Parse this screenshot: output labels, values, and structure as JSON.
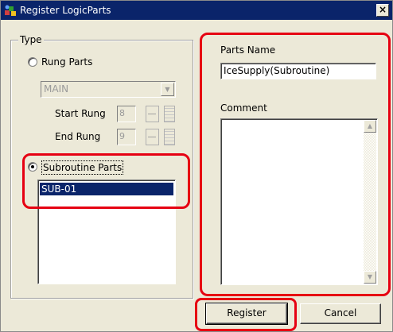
{
  "window": {
    "title": "Register LogicParts",
    "close_glyph": "×",
    "app_icon": "logicparts-app-icon"
  },
  "type_group": {
    "legend": "Type",
    "rung_parts": {
      "label": "Rung Parts",
      "checked": false,
      "combo_value": "MAIN",
      "start_label": "Start Rung",
      "start_value": "8",
      "end_label": "End Rung",
      "end_value": "9"
    },
    "subroutine_parts": {
      "label": "Subroutine Parts",
      "checked": true,
      "items": [
        "SUB-01"
      ],
      "selected_index": 0
    }
  },
  "parts_name": {
    "label": "Parts Name",
    "value": "IceSupply(Subroutine)"
  },
  "comment": {
    "label": "Comment",
    "value": ""
  },
  "buttons": {
    "register": "Register",
    "cancel": "Cancel"
  },
  "glyphs": {
    "dropdown": "▼",
    "scroll_up": "▲",
    "scroll_down": "▼"
  },
  "colors": {
    "highlight": "#e60012",
    "selection": "#0a246a",
    "titlebar": "#0a246a",
    "dialog_bg": "#ece9d8"
  }
}
